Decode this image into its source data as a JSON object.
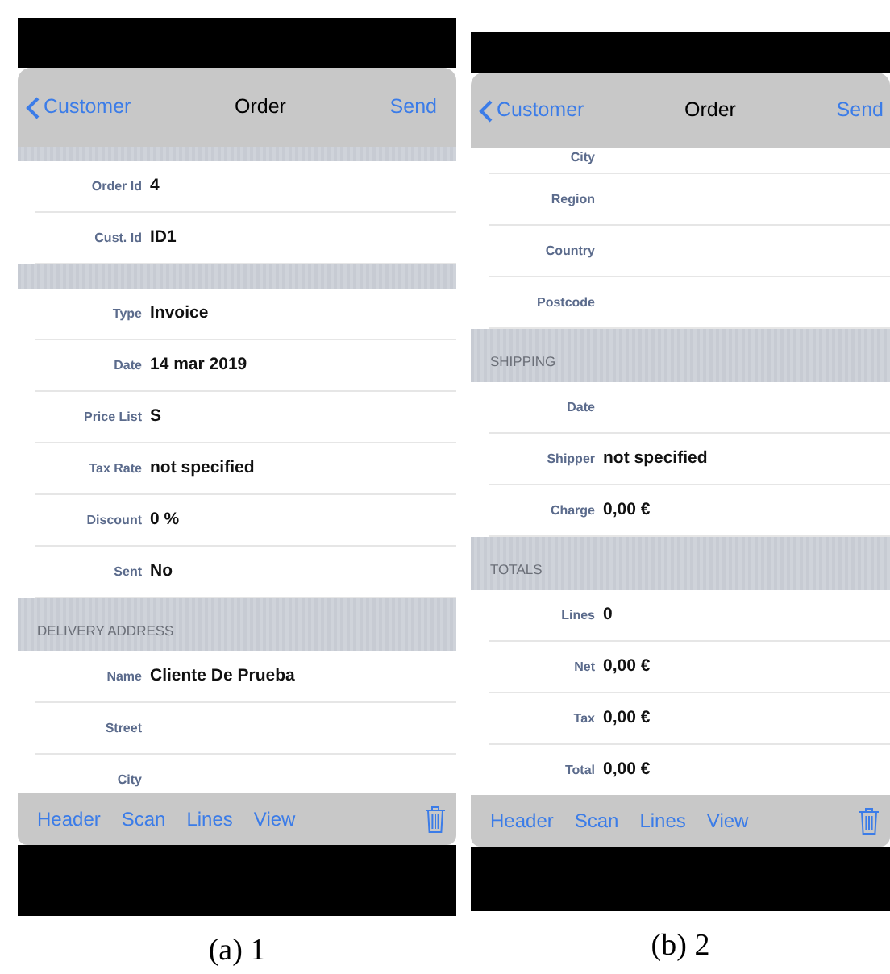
{
  "panels": [
    {
      "caption": "(a) 1",
      "nav": {
        "back": "Customer",
        "title": "Order",
        "action": "Send"
      },
      "sections": [
        {
          "kind": "banded",
          "rows": [
            {
              "label": "Order Id",
              "value": "4"
            },
            {
              "label": "Cust. Id",
              "value": "ID1"
            }
          ]
        },
        {
          "kind": "banded",
          "rows": [
            {
              "label": "Type",
              "value": "Invoice"
            },
            {
              "label": "Date",
              "value": "14 mar 2019"
            },
            {
              "label": "Price List",
              "value": "S"
            },
            {
              "label": "Tax Rate",
              "value": "not specified"
            },
            {
              "label": "Discount",
              "value": "0 %"
            },
            {
              "label": "Sent",
              "value": "No"
            }
          ]
        },
        {
          "kind": "banded",
          "title": "DELIVERY ADDRESS",
          "rows": [
            {
              "label": "Name",
              "value": "Cliente De Prueba"
            },
            {
              "label": "Street"
            },
            {
              "label": "City"
            }
          ]
        }
      ],
      "toolbar": [
        "Header",
        "Scan",
        "Lines",
        "View"
      ]
    },
    {
      "caption": "(b) 2",
      "nav": {
        "back": "Customer",
        "title": "Order",
        "action": "Send"
      },
      "sections": [
        {
          "kind": "continued",
          "rows": [
            {
              "label": "City"
            },
            {
              "label": "Region"
            },
            {
              "label": "Country"
            },
            {
              "label": "Postcode"
            }
          ]
        },
        {
          "kind": "banded",
          "title": "SHIPPING",
          "rows": [
            {
              "label": "Date"
            },
            {
              "label": "Shipper",
              "value": "not specified"
            },
            {
              "label": "Charge",
              "value": "0,00 €"
            }
          ]
        },
        {
          "kind": "banded",
          "title": "TOTALS",
          "rows": [
            {
              "label": "Lines",
              "value": "0"
            },
            {
              "label": "Net",
              "value": "0,00 €"
            },
            {
              "label": "Tax",
              "value": "0,00 €"
            },
            {
              "label": "Total",
              "value": "0,00 €"
            }
          ]
        }
      ],
      "toolbar": [
        "Header",
        "Scan",
        "Lines",
        "View"
      ]
    }
  ]
}
